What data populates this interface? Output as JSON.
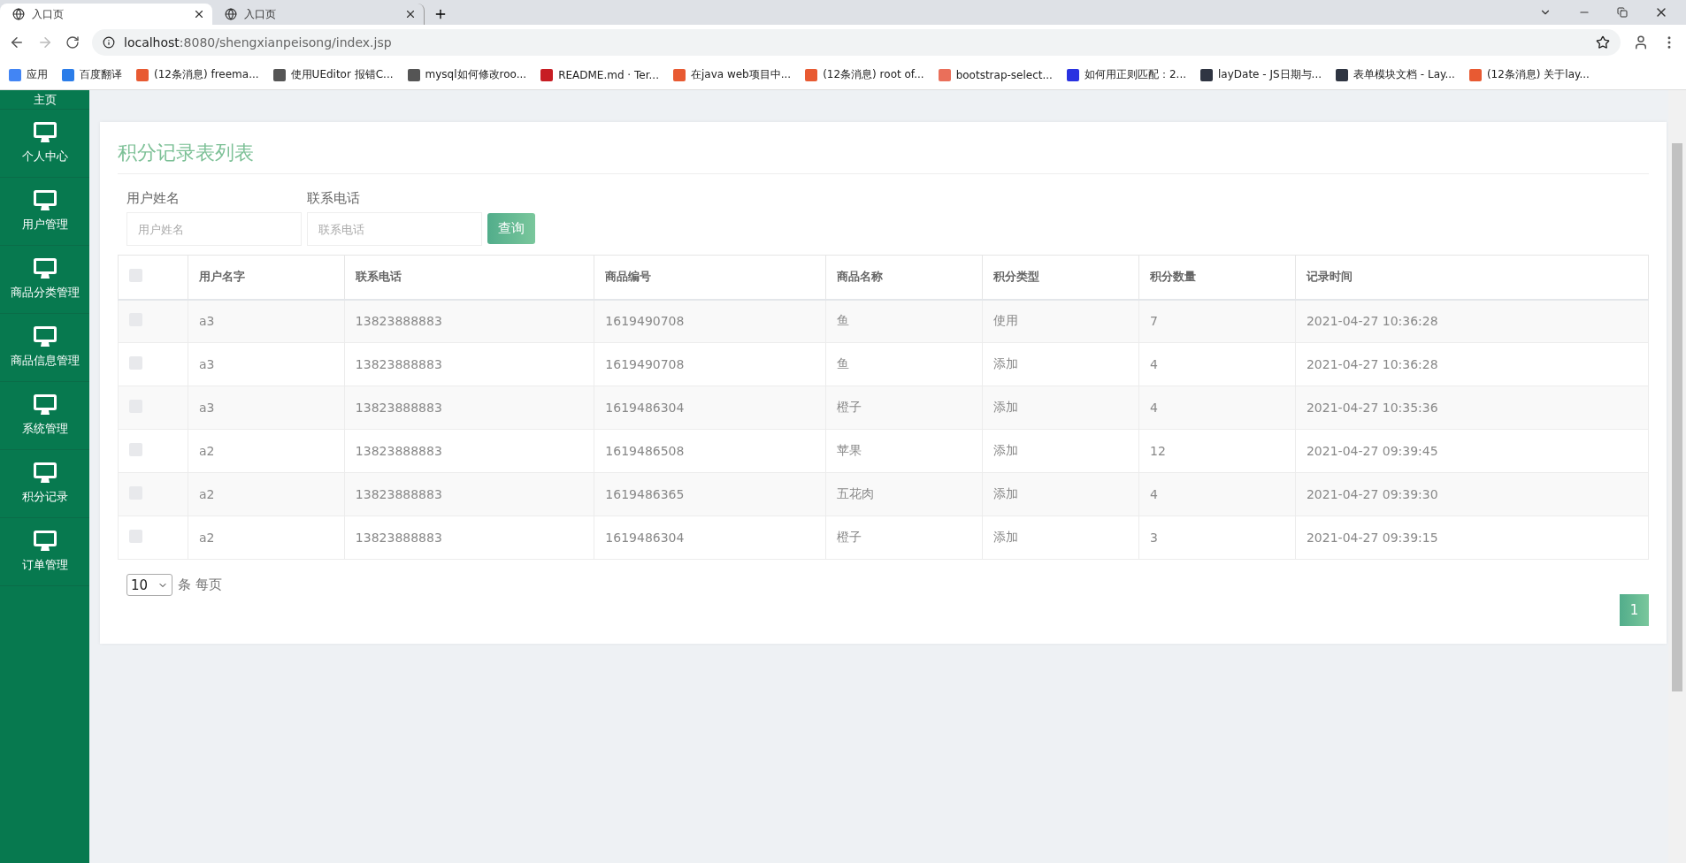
{
  "browser": {
    "tabs": [
      {
        "title": "入口页",
        "selected": true
      },
      {
        "title": "入口页",
        "selected": false
      }
    ],
    "address": {
      "host": "localhost",
      "path": ":8080/shengxianpeisong/index.jsp"
    },
    "bookmarks": [
      {
        "label": "应用",
        "kind": "apps"
      },
      {
        "label": "百度翻译",
        "kind": "translate"
      },
      {
        "label": "(12条消息) freema...",
        "kind": "csdn"
      },
      {
        "label": "使用UEditor 报错C...",
        "kind": "ue"
      },
      {
        "label": "mysql如何修改roo...",
        "kind": "ue"
      },
      {
        "label": "README.md · Ter...",
        "kind": "gitee"
      },
      {
        "label": "在java web项目中...",
        "kind": "csdn"
      },
      {
        "label": "(12条消息) root of...",
        "kind": "csdn"
      },
      {
        "label": "bootstrap-select...",
        "kind": "jianshu"
      },
      {
        "label": "如何用正则匹配：2...",
        "kind": "baidu"
      },
      {
        "label": "layDate - JS日期与...",
        "kind": "layui"
      },
      {
        "label": "表单模块文档 - Lay...",
        "kind": "layui"
      },
      {
        "label": "(12条消息) 关于lay...",
        "kind": "csdn"
      }
    ]
  },
  "sidebar": {
    "items": [
      {
        "label": "主页",
        "icon": false
      },
      {
        "label": "个人中心",
        "icon": true
      },
      {
        "label": "用户管理",
        "icon": true
      },
      {
        "label": "商品分类管理",
        "icon": true
      },
      {
        "label": "商品信息管理",
        "icon": true
      },
      {
        "label": "系统管理",
        "icon": true
      },
      {
        "label": "积分记录",
        "icon": true
      },
      {
        "label": "订单管理",
        "icon": true
      }
    ]
  },
  "panel": {
    "title": "积分记录表列表",
    "filters": [
      {
        "label": "用户姓名",
        "placeholder": "用户姓名"
      },
      {
        "label": "联系电话",
        "placeholder": "联系电话"
      }
    ],
    "search_button": "查询",
    "table": {
      "header_checked": false,
      "columns": [
        "用户名字",
        "联系电话",
        "商品编号",
        "商品名称",
        "积分类型",
        "积分数量",
        "记录时间"
      ],
      "rows": [
        {
          "checked": false,
          "cells": [
            "a3",
            "13823888883",
            "1619490708",
            "鱼",
            "使用",
            "7",
            "2021-04-27 10:36:28"
          ]
        },
        {
          "checked": false,
          "cells": [
            "a3",
            "13823888883",
            "1619490708",
            "鱼",
            "添加",
            "4",
            "2021-04-27 10:36:28"
          ]
        },
        {
          "checked": false,
          "cells": [
            "a3",
            "13823888883",
            "1619486304",
            "橙子",
            "添加",
            "4",
            "2021-04-27 10:35:36"
          ]
        },
        {
          "checked": false,
          "cells": [
            "a2",
            "13823888883",
            "1619486508",
            "苹果",
            "添加",
            "12",
            "2021-04-27 09:39:45"
          ]
        },
        {
          "checked": false,
          "cells": [
            "a2",
            "13823888883",
            "1619486365",
            "五花肉",
            "添加",
            "4",
            "2021-04-27 09:39:30"
          ]
        },
        {
          "checked": false,
          "cells": [
            "a2",
            "13823888883",
            "1619486304",
            "橙子",
            "添加",
            "3",
            "2021-04-27 09:39:15"
          ]
        }
      ]
    },
    "page_size": "10",
    "page_size_suffix": "条 每页",
    "pages": [
      {
        "label": "1",
        "selected": true
      }
    ]
  }
}
